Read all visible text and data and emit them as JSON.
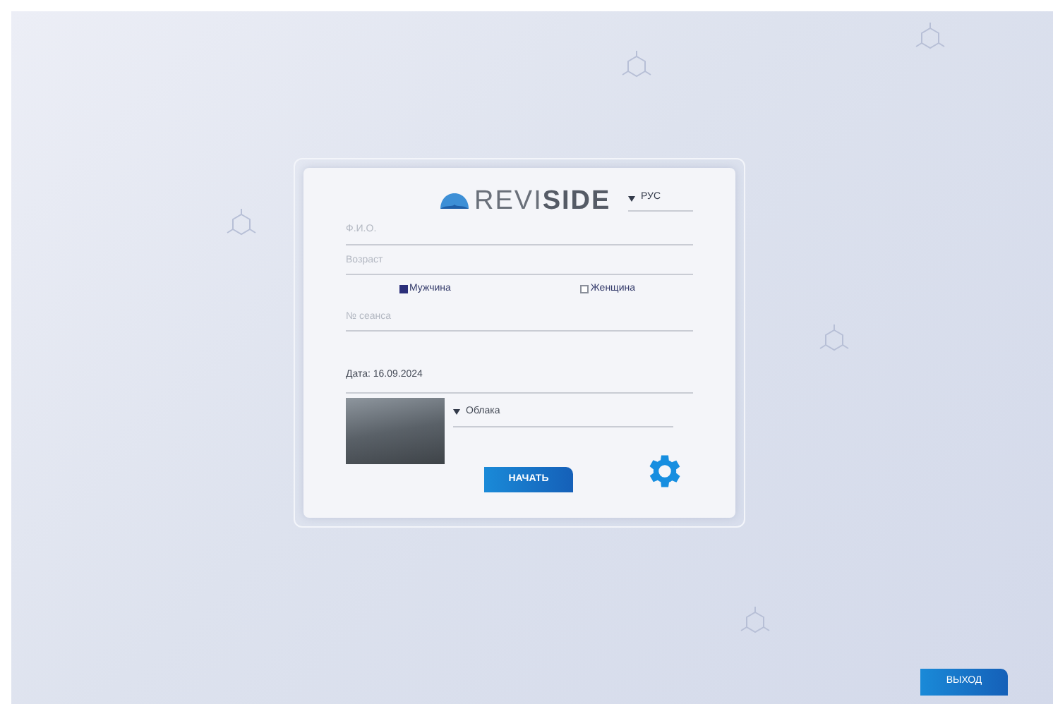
{
  "logo": {
    "text_light": "REVI",
    "text_bold": "SIDE"
  },
  "language": {
    "value": "РУС"
  },
  "fields": [
    {
      "placeholder": "Ф.И.О."
    },
    {
      "placeholder": "Возраст"
    }
  ],
  "gender": [
    {
      "label": "Мужчина",
      "selected": true
    },
    {
      "label": "Женщина",
      "selected": false
    }
  ],
  "session": {
    "placeholder": "№ сеанса"
  },
  "date": "Дата: 16.09.2024",
  "scene": {
    "value": "Облака"
  },
  "start_button": "НАЧАТЬ",
  "exit_button": "ВЫХОД"
}
